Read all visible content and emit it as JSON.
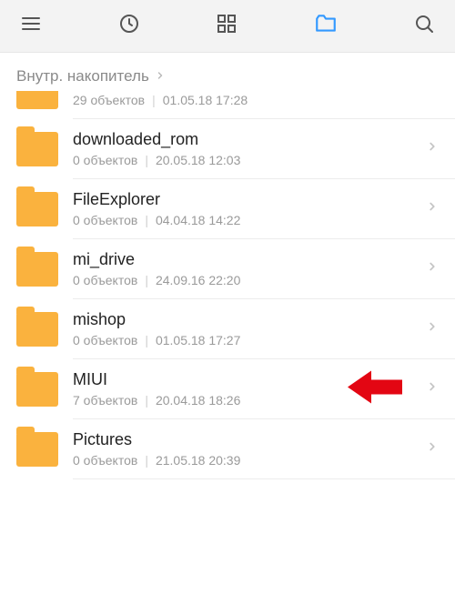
{
  "breadcrumb": {
    "label": "Внутр. накопитель"
  },
  "items": [
    {
      "name": "",
      "count": "29 объектов",
      "date": "01.05.18 17:28",
      "partial": true
    },
    {
      "name": "downloaded_rom",
      "count": "0 объектов",
      "date": "20.05.18 12:03"
    },
    {
      "name": "FileExplorer",
      "count": "0 объектов",
      "date": "04.04.18 14:22"
    },
    {
      "name": "mi_drive",
      "count": "0 объектов",
      "date": "24.09.16 22:20"
    },
    {
      "name": "mishop",
      "count": "0 объектов",
      "date": "01.05.18 17:27"
    },
    {
      "name": "MIUI",
      "count": "7 объектов",
      "date": "20.04.18 18:26",
      "highlight": true
    },
    {
      "name": "Pictures",
      "count": "0 объектов",
      "date": "21.05.18 20:39"
    }
  ]
}
